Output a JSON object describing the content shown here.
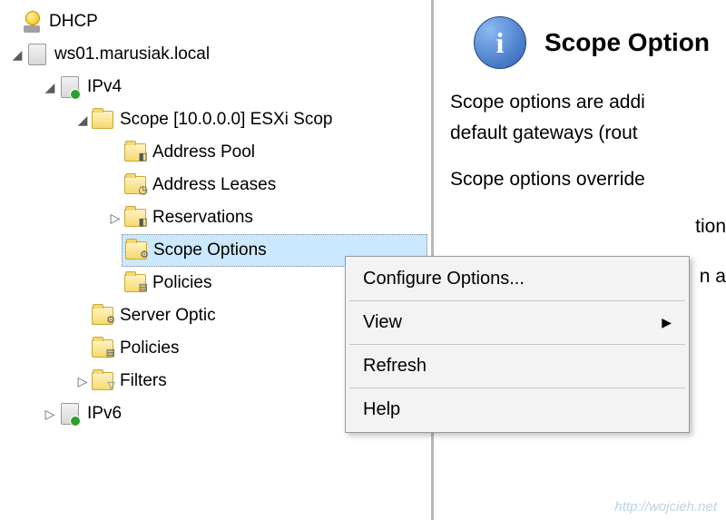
{
  "tree": {
    "root": "DHCP",
    "server": "ws01.marusiak.local",
    "ipv4": "IPv4",
    "scope": "Scope [10.0.0.0] ESXi Scop",
    "address_pool": "Address Pool",
    "address_leases": "Address Leases",
    "reservations": "Reservations",
    "scope_options": "Scope Options",
    "policies": "Policies",
    "server_options": "Server Optic",
    "policies2": "Policies",
    "filters": "Filters",
    "ipv6": "IPv6"
  },
  "context_menu": {
    "configure": "Configure Options...",
    "view": "View",
    "refresh": "Refresh",
    "help": "Help"
  },
  "details": {
    "title": "Scope Option",
    "para1a": "Scope options are addi",
    "para1b": "default gateways (rout",
    "para2": "Scope options override",
    "para3a": "tion",
    "para3b": "n a"
  },
  "watermark": "http://wojcieh.net"
}
